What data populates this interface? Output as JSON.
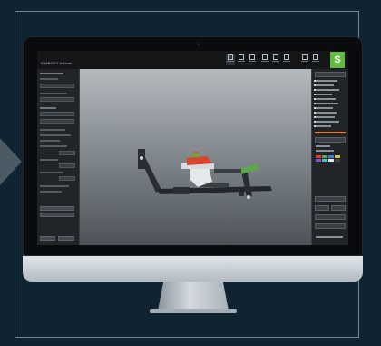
{
  "app": {
    "logo_text": "SIMBODY Artisan",
    "green_button": "S"
  },
  "colors": {
    "page_background": "#0f2430",
    "accent_green": "#62bb3e",
    "accent_orange": "#e07a3a",
    "model_red": "#d8442c",
    "model_green": "#5ea84a",
    "model_dark": "#2a2e32"
  },
  "toolbar": {
    "tools": [
      "select-icon",
      "move-icon",
      "rotate-icon",
      "scale-icon",
      "close-icon",
      "reset-icon",
      "settings-icon",
      "view-icon"
    ]
  },
  "icons": {
    "arrow": "triangle-right-icon"
  }
}
